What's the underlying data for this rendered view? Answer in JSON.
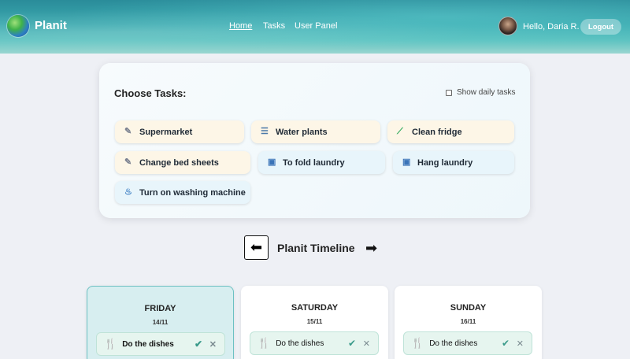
{
  "header": {
    "brand": "Planit",
    "nav": [
      "Home",
      "Tasks",
      "User Panel"
    ],
    "greeting": "Hello, Daria R.",
    "logout": "Logout"
  },
  "tasks_card": {
    "title": "Choose Tasks:",
    "daily_label": "Show daily tasks",
    "chips": [
      {
        "label": "Supermarket",
        "icon": "pencil-icon"
      },
      {
        "label": "Water plants",
        "icon": "water-lines-icon"
      },
      {
        "label": "Clean fridge",
        "icon": "broom-icon"
      },
      {
        "label": "Change bed sheets",
        "icon": "pencil-icon"
      },
      {
        "label": "To fold laundry",
        "icon": "laundry-icon"
      },
      {
        "label": "Hang laundry",
        "icon": "laundry-icon"
      },
      {
        "label": "Turn on washing machine",
        "icon": "washing-machine-icon"
      }
    ]
  },
  "timeline": {
    "title": "Planit Timeline",
    "days": [
      {
        "name": "FRIDAY",
        "date": "14/11",
        "task": "Do the dishes"
      },
      {
        "name": "SATURDAY",
        "date": "15/11",
        "task": "Do the dishes"
      },
      {
        "name": "SUNDAY",
        "date": "16/11",
        "task": "Do the dishes"
      }
    ]
  },
  "colors": {
    "accent": "#5cc2c0",
    "active_day": "#d7eef0"
  }
}
